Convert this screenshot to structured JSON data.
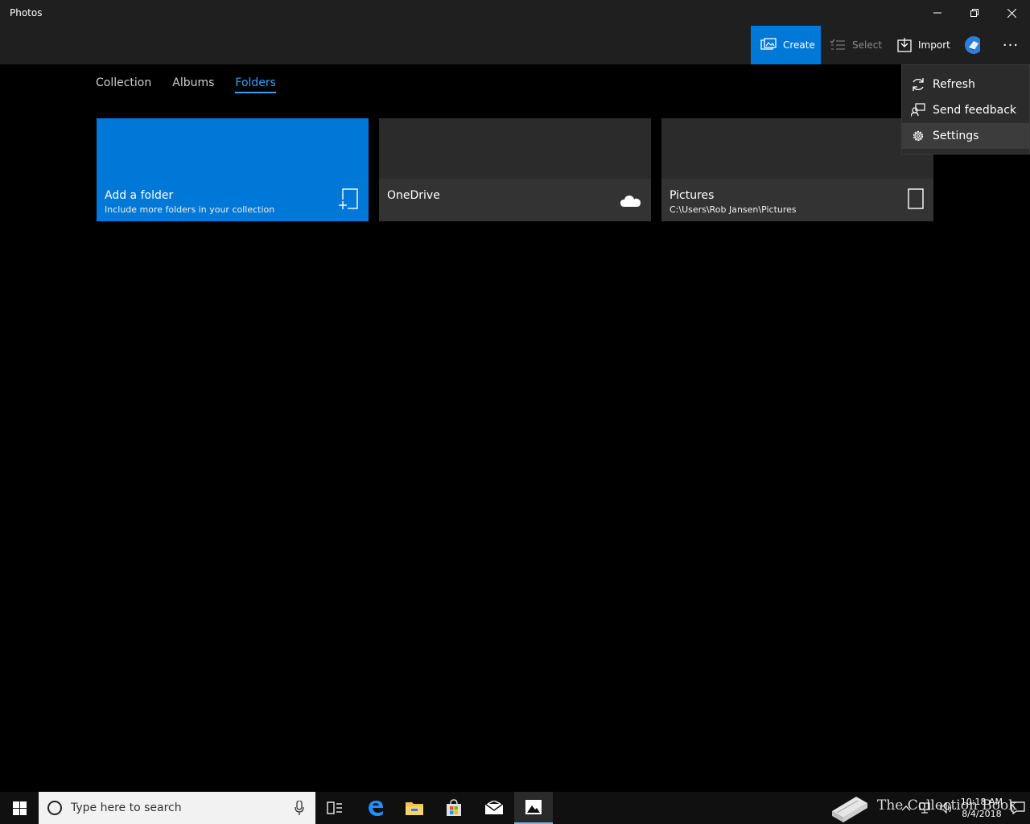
{
  "window": {
    "title": "Photos"
  },
  "commandbar": {
    "create_label": "Create",
    "select_label": "Select",
    "import_label": "Import",
    "more_label": "···"
  },
  "tabs": [
    {
      "label": "Collection",
      "active": false
    },
    {
      "label": "Albums",
      "active": false
    },
    {
      "label": "Folders",
      "active": true
    }
  ],
  "folders": [
    {
      "title": "Add a folder",
      "subtitle": "Include more folders in your collection",
      "icon": "add-folder-icon"
    },
    {
      "title": "OneDrive",
      "subtitle": "",
      "icon": "cloud-icon"
    },
    {
      "title": "Pictures",
      "subtitle": "C:\\Users\\Rob Jansen\\Pictures",
      "icon": "folder-icon"
    }
  ],
  "menu": {
    "items": [
      {
        "label": "Refresh",
        "icon": "refresh-icon"
      },
      {
        "label": "Send feedback",
        "icon": "feedback-icon"
      },
      {
        "label": "Settings",
        "icon": "gear-icon"
      }
    ]
  },
  "taskbar": {
    "search_placeholder": "Type here to search",
    "watermark": "The Collection Book",
    "time": "10:18 AM",
    "date": "8/4/2018"
  },
  "colors": {
    "accent": "#0078d7",
    "tab_active": "#3aa0f2",
    "titlebar": "#1f1f1f",
    "tile": "#2b2b2b"
  }
}
